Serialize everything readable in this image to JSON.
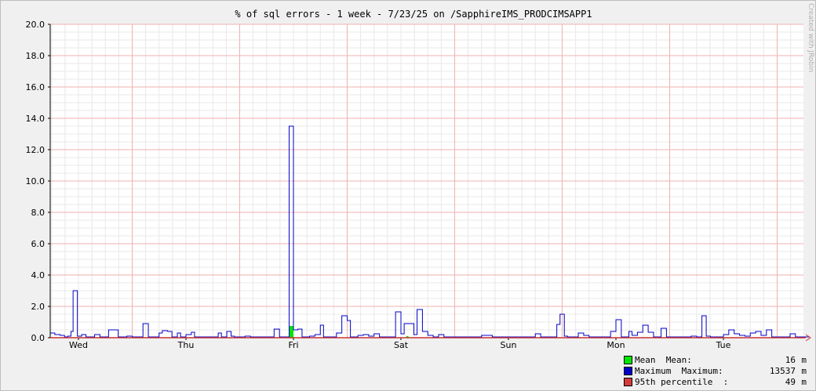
{
  "chart_data": {
    "type": "line",
    "title": "% of sql errors - 1 week - 7/23/25 on /SapphireIMS_PRODCIMSAPP1",
    "watermark": "Created with JRobin",
    "x_unit": "day index (0 = Wed midnight)",
    "xlim": [
      -0.27,
      6.8
    ],
    "ylim": [
      0,
      20
    ],
    "y_ticks": [
      "0.0",
      "2.0",
      "4.0",
      "6.0",
      "8.0",
      "10.0",
      "12.0",
      "14.0",
      "16.0",
      "18.0",
      "20.0"
    ],
    "x_ticks": [
      {
        "label": "Wed",
        "value": 0
      },
      {
        "label": "Thu",
        "value": 1
      },
      {
        "label": "Fri",
        "value": 2
      },
      {
        "label": "Sat",
        "value": 3
      },
      {
        "label": "Sun",
        "value": 4
      },
      {
        "label": "Mon",
        "value": 5
      },
      {
        "label": "Tue",
        "value": 6
      }
    ],
    "series": [
      {
        "name": "Maximum",
        "color": "#0000c8",
        "step": true,
        "points": [
          [
            -0.27,
            0.3
          ],
          [
            -0.22,
            0.2
          ],
          [
            -0.17,
            0.15
          ],
          [
            -0.13,
            0.05
          ],
          [
            -0.1,
            0.1
          ],
          [
            -0.07,
            0.4
          ],
          [
            -0.05,
            3.0
          ],
          [
            -0.01,
            0.1
          ],
          [
            0.03,
            0.2
          ],
          [
            0.07,
            0.05
          ],
          [
            0.15,
            0.2
          ],
          [
            0.2,
            0.05
          ],
          [
            0.28,
            0.5
          ],
          [
            0.37,
            0.05
          ],
          [
            0.45,
            0.1
          ],
          [
            0.5,
            0.05
          ],
          [
            0.6,
            0.9
          ],
          [
            0.65,
            0.05
          ],
          [
            0.75,
            0.3
          ],
          [
            0.78,
            0.45
          ],
          [
            0.83,
            0.4
          ],
          [
            0.87,
            0.05
          ],
          [
            0.92,
            0.3
          ],
          [
            0.95,
            0.05
          ],
          [
            1.0,
            0.2
          ],
          [
            1.05,
            0.35
          ],
          [
            1.08,
            0.05
          ],
          [
            1.3,
            0.3
          ],
          [
            1.33,
            0.05
          ],
          [
            1.38,
            0.4
          ],
          [
            1.42,
            0.1
          ],
          [
            1.45,
            0.05
          ],
          [
            1.55,
            0.1
          ],
          [
            1.6,
            0.05
          ],
          [
            1.82,
            0.55
          ],
          [
            1.87,
            0.05
          ],
          [
            1.96,
            13.5
          ],
          [
            2.0,
            0.5
          ],
          [
            2.04,
            0.55
          ],
          [
            2.08,
            0.05
          ],
          [
            2.15,
            0.1
          ],
          [
            2.2,
            0.2
          ],
          [
            2.25,
            0.8
          ],
          [
            2.28,
            0.05
          ],
          [
            2.4,
            0.3
          ],
          [
            2.45,
            1.4
          ],
          [
            2.5,
            1.1
          ],
          [
            2.53,
            0.05
          ],
          [
            2.6,
            0.15
          ],
          [
            2.65,
            0.2
          ],
          [
            2.7,
            0.1
          ],
          [
            2.75,
            0.25
          ],
          [
            2.8,
            0.05
          ],
          [
            2.95,
            1.65
          ],
          [
            3.0,
            0.25
          ],
          [
            3.03,
            0.9
          ],
          [
            3.1,
            0.9
          ],
          [
            3.12,
            0.2
          ],
          [
            3.15,
            1.8
          ],
          [
            3.2,
            0.4
          ],
          [
            3.25,
            0.15
          ],
          [
            3.3,
            0.05
          ],
          [
            3.35,
            0.2
          ],
          [
            3.4,
            0.05
          ],
          [
            3.5,
            0.05
          ],
          [
            3.75,
            0.15
          ],
          [
            3.85,
            0.05
          ],
          [
            4.0,
            0.05
          ],
          [
            4.25,
            0.25
          ],
          [
            4.3,
            0.05
          ],
          [
            4.45,
            0.85
          ],
          [
            4.48,
            1.5
          ],
          [
            4.52,
            0.1
          ],
          [
            4.55,
            0.05
          ],
          [
            4.65,
            0.3
          ],
          [
            4.7,
            0.15
          ],
          [
            4.75,
            0.05
          ],
          [
            4.95,
            0.4
          ],
          [
            5.0,
            1.15
          ],
          [
            5.05,
            0.05
          ],
          [
            5.12,
            0.4
          ],
          [
            5.15,
            0.15
          ],
          [
            5.2,
            0.35
          ],
          [
            5.25,
            0.8
          ],
          [
            5.3,
            0.35
          ],
          [
            5.35,
            0.05
          ],
          [
            5.42,
            0.6
          ],
          [
            5.47,
            0.05
          ],
          [
            5.7,
            0.1
          ],
          [
            5.75,
            0.05
          ],
          [
            5.8,
            1.4
          ],
          [
            5.84,
            0.1
          ],
          [
            5.88,
            0.05
          ],
          [
            6.0,
            0.2
          ],
          [
            6.05,
            0.5
          ],
          [
            6.1,
            0.25
          ],
          [
            6.15,
            0.15
          ],
          [
            6.2,
            0.1
          ],
          [
            6.25,
            0.3
          ],
          [
            6.3,
            0.4
          ],
          [
            6.35,
            0.15
          ],
          [
            6.4,
            0.5
          ],
          [
            6.45,
            0.05
          ],
          [
            6.62,
            0.25
          ],
          [
            6.67,
            0.05
          ],
          [
            6.8,
            0.05
          ]
        ]
      },
      {
        "name": "Mean",
        "color": "#00e600",
        "bars": [
          [
            1.96,
            2.0,
            0.75
          ],
          [
            3.05,
            3.07,
            0.1
          ]
        ]
      }
    ],
    "legend": [
      {
        "label": "Mean  Mean:",
        "value": "16",
        "unit": "m",
        "color": "#00e600"
      },
      {
        "label": "Maximum  Maximum:",
        "value": "13537",
        "unit": "m",
        "color": "#0000c8"
      },
      {
        "label": "95th percentile  :",
        "value": "49",
        "unit": "m",
        "color": "#d23c3c"
      }
    ],
    "legend_position": "bottom-right",
    "grid": true
  }
}
